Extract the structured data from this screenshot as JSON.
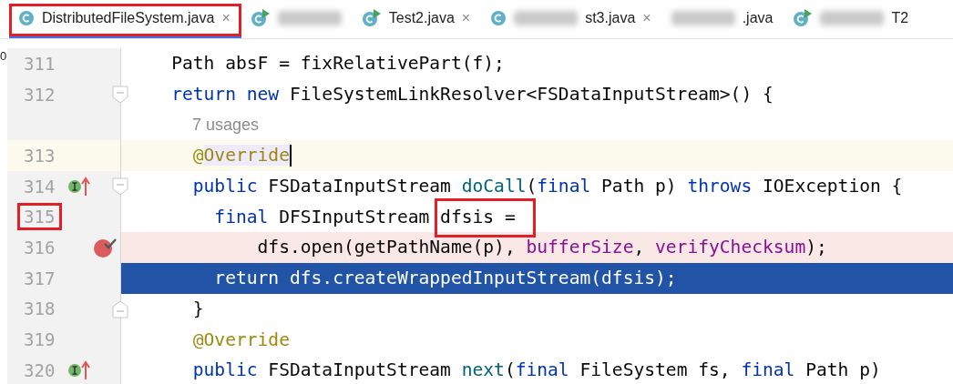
{
  "tabs": [
    {
      "kind": "class",
      "label": "DistributedFileSystem.java",
      "blurred": false,
      "close": "×",
      "selected": true,
      "marked": true
    },
    {
      "kind": "test",
      "blurred": true,
      "selected": false,
      "marked": false
    },
    {
      "kind": "test",
      "label": "Test2.java",
      "blurred": false,
      "close": "×",
      "selected": false,
      "marked": false
    },
    {
      "kind": "class",
      "label": "st3.java",
      "blurred": true,
      "close": "×",
      "selected": false,
      "marked": false
    },
    {
      "label": ".java",
      "blurred": true,
      "selected": false,
      "marked": false
    },
    {
      "kind": "test",
      "label": "T2",
      "blurred": true,
      "selected": false,
      "marked": false
    }
  ],
  "side_fragment": "0",
  "lines": [
    {
      "kind": "code",
      "number": "311",
      "tokens": [
        {
          "kind": "plain",
          "text": "    Path absF = fixRelativePart(f);"
        }
      ]
    },
    {
      "kind": "code",
      "number": "312",
      "fold_start": true,
      "tokens": [
        {
          "kind": "kw",
          "text": "    return new "
        },
        {
          "kind": "plain",
          "text": "FileSystemLinkResolver<FSDataInputStream>() {"
        }
      ]
    },
    {
      "kind": "hint",
      "text": "7 usages"
    },
    {
      "kind": "code",
      "number": "313",
      "current": true,
      "caret": true,
      "tokens": [
        {
          "kind": "ann",
          "text": "      @"
        },
        {
          "kind": "ann-hl",
          "text": "Override"
        }
      ]
    },
    {
      "kind": "code",
      "number": "314",
      "fold_start": true,
      "implements": true,
      "tokens": [
        {
          "kind": "kw",
          "text": "      public "
        },
        {
          "kind": "plain",
          "text": "FSDataInputStream "
        },
        {
          "kind": "fn",
          "text": "doCall"
        },
        {
          "kind": "plain",
          "text": "("
        },
        {
          "kind": "kw",
          "text": "final "
        },
        {
          "kind": "plain",
          "text": "Path p) "
        },
        {
          "kind": "kw",
          "text": "throws "
        },
        {
          "kind": "plain",
          "text": "IOException {"
        }
      ]
    },
    {
      "kind": "code",
      "number": "315",
      "marked": true,
      "tokens": [
        {
          "kind": "kw",
          "text": "        final "
        },
        {
          "kind": "plain",
          "text": "DFSInputStream "
        },
        {
          "kind": "marked",
          "text": "dfsis ="
        }
      ]
    },
    {
      "kind": "code",
      "number": "316",
      "breakpoint": true,
      "tokens": [
        {
          "kind": "plain",
          "text": "            dfs.open(getPathName(p), "
        },
        {
          "kind": "field",
          "text": "bufferSize"
        },
        {
          "kind": "plain",
          "text": ", "
        },
        {
          "kind": "field",
          "text": "verifyChecksum"
        },
        {
          "kind": "plain",
          "text": ");"
        }
      ]
    },
    {
      "kind": "code",
      "number": "317",
      "execution": true,
      "tokens": [
        {
          "kind": "kw",
          "text": "        return "
        },
        {
          "kind": "plain",
          "text": "dfs.createWrappedInputStream(dfsis);"
        }
      ]
    },
    {
      "kind": "code",
      "number": "318",
      "fold_end": true,
      "tokens": [
        {
          "kind": "plain",
          "text": "      }"
        }
      ]
    },
    {
      "kind": "code",
      "number": "319",
      "tokens": [
        {
          "kind": "ann",
          "text": "      @Override"
        }
      ]
    },
    {
      "kind": "code",
      "number": "320",
      "implements": true,
      "tokens": [
        {
          "kind": "kw",
          "text": "      public "
        },
        {
          "kind": "plain",
          "text": "FSDataInputStream "
        },
        {
          "kind": "fn",
          "text": "next"
        },
        {
          "kind": "plain",
          "text": "("
        },
        {
          "kind": "kw",
          "text": "final "
        },
        {
          "kind": "plain",
          "text": "FileSystem fs, "
        },
        {
          "kind": "kw",
          "text": "final "
        },
        {
          "kind": "plain",
          "text": "Path p)"
        }
      ]
    }
  ]
}
